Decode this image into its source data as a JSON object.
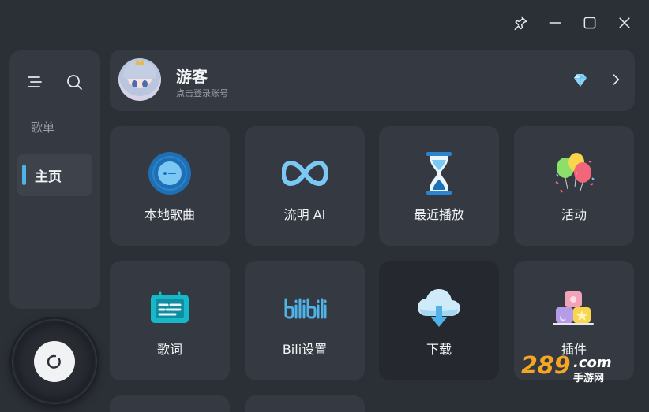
{
  "window_controls": [
    "pin-icon",
    "minimize-icon",
    "maximize-icon",
    "close-icon"
  ],
  "sidebar": {
    "icons": [
      "menu-icon",
      "search-icon"
    ],
    "section_title": "歌单",
    "items": [
      {
        "label": "主页",
        "active": true
      }
    ]
  },
  "account": {
    "name": "游客",
    "subtitle": "点击登录账号",
    "badge_icon": "diamond-icon",
    "arrow_icon": "chevron-right-icon"
  },
  "tiles": [
    {
      "label": "本地歌曲",
      "icon": "vinyl-disc-icon"
    },
    {
      "label": "流明 AI",
      "icon": "infinity-icon"
    },
    {
      "label": "最近播放",
      "icon": "hourglass-icon"
    },
    {
      "label": "活动",
      "icon": "balloons-icon"
    },
    {
      "label": "歌词",
      "icon": "lyrics-screen-icon"
    },
    {
      "label": "Bili设置",
      "icon": "bilibili-logo-icon"
    },
    {
      "label": "下载",
      "icon": "cloud-download-icon"
    },
    {
      "label": "插件",
      "icon": "blocks-icon"
    }
  ],
  "player": {
    "icon": "loading-spinner-icon"
  },
  "watermark": {
    "number": "289",
    "domain": ".com",
    "cn": "手游网"
  },
  "colors": {
    "background": "#2b2f36",
    "card": "#353a42",
    "accent": "#4fb3e8"
  }
}
